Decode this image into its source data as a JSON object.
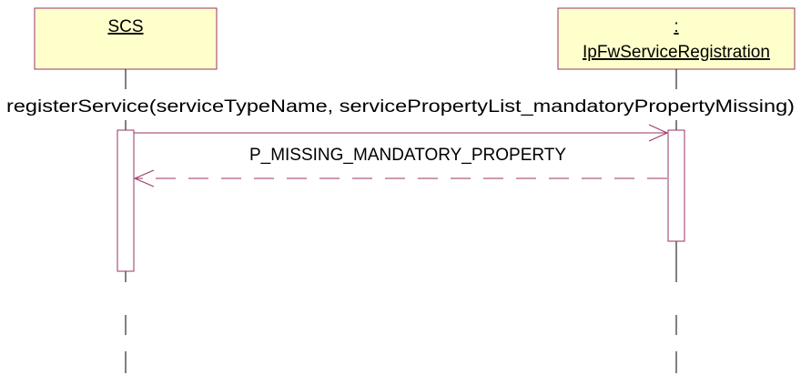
{
  "diagram": {
    "participants": [
      {
        "id": "scs",
        "label": "SCS"
      },
      {
        "id": "fw",
        "label_top": ":",
        "label": "IpFwServiceRegistration"
      }
    ],
    "messages": [
      {
        "from": "scs",
        "to": "fw",
        "label": "registerService(serviceTypeName, servicePropertyList_mandatoryPropertyMissing)",
        "style": "solid"
      },
      {
        "from": "fw",
        "to": "scs",
        "label": "P_MISSING_MANDATORY_PROPERTY",
        "style": "dashed"
      }
    ],
    "colors": {
      "box_fill": "#ffffcc",
      "line": "#993366",
      "lifeline": "#000000"
    }
  }
}
